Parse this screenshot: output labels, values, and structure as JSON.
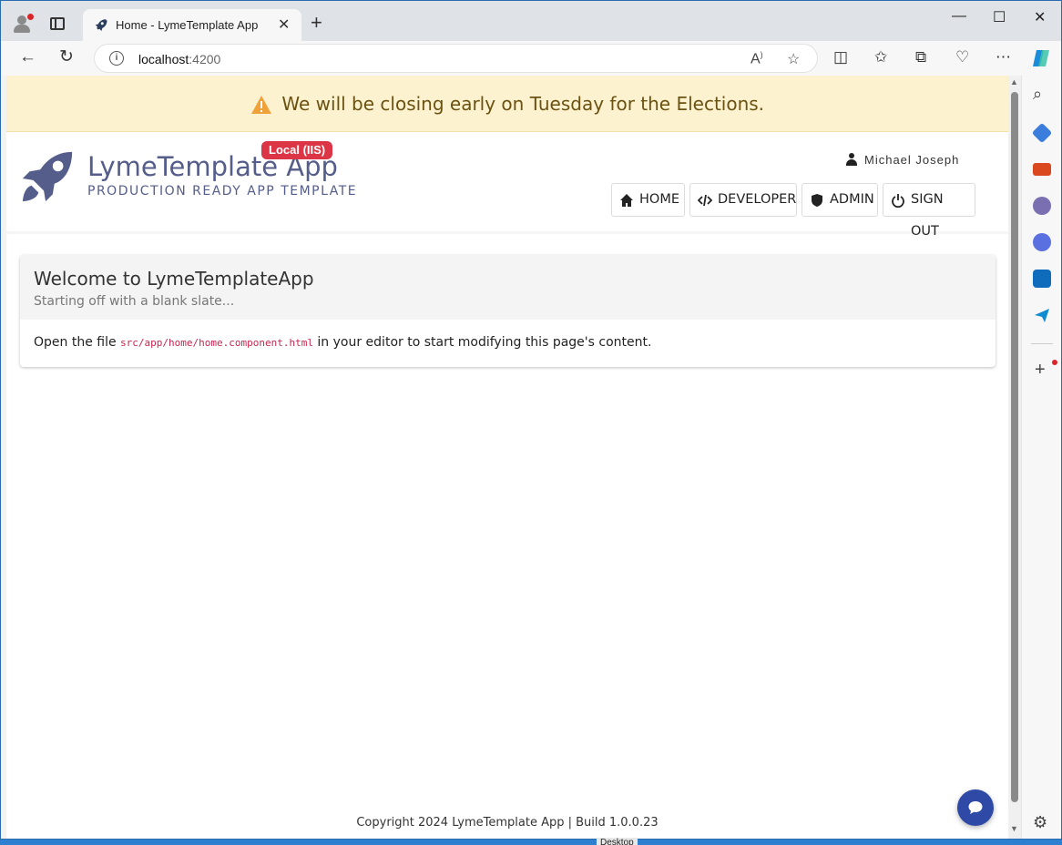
{
  "browser": {
    "tab_title": "Home - LymeTemplate App",
    "url_host": "localhost",
    "url_port": ":4200",
    "minimize": "—",
    "maximize": "☐",
    "close": "✕"
  },
  "alert": {
    "message": "We will be closing early on Tuesday for the Elections."
  },
  "header": {
    "app_title": "LymeTemplate App",
    "app_subtitle": "PRODUCTION READY APP TEMPLATE",
    "env_badge": "Local (IIS)",
    "user_name": "Michael Joseph",
    "nav": {
      "home": "HOME",
      "developer": "DEVELOPER",
      "admin": "ADMIN",
      "sign_out": "SIGN OUT"
    }
  },
  "card": {
    "title": "Welcome to LymeTemplateApp",
    "subtitle": "Starting off with a blank slate...",
    "body_prefix": "Open the file ",
    "body_code": "src/app/home/home.component.html",
    "body_suffix": " in your editor to start modifying this page's content."
  },
  "footer": {
    "text": "Copyright 2024 LymeTemplate App | Build 1.0.0.23"
  },
  "taskbar": {
    "label": "Desktop"
  },
  "colors": {
    "brand": "#555d8a",
    "alert_bg": "#fcf2cf",
    "badge": "#dc3545",
    "chat": "#2f4aa6"
  }
}
